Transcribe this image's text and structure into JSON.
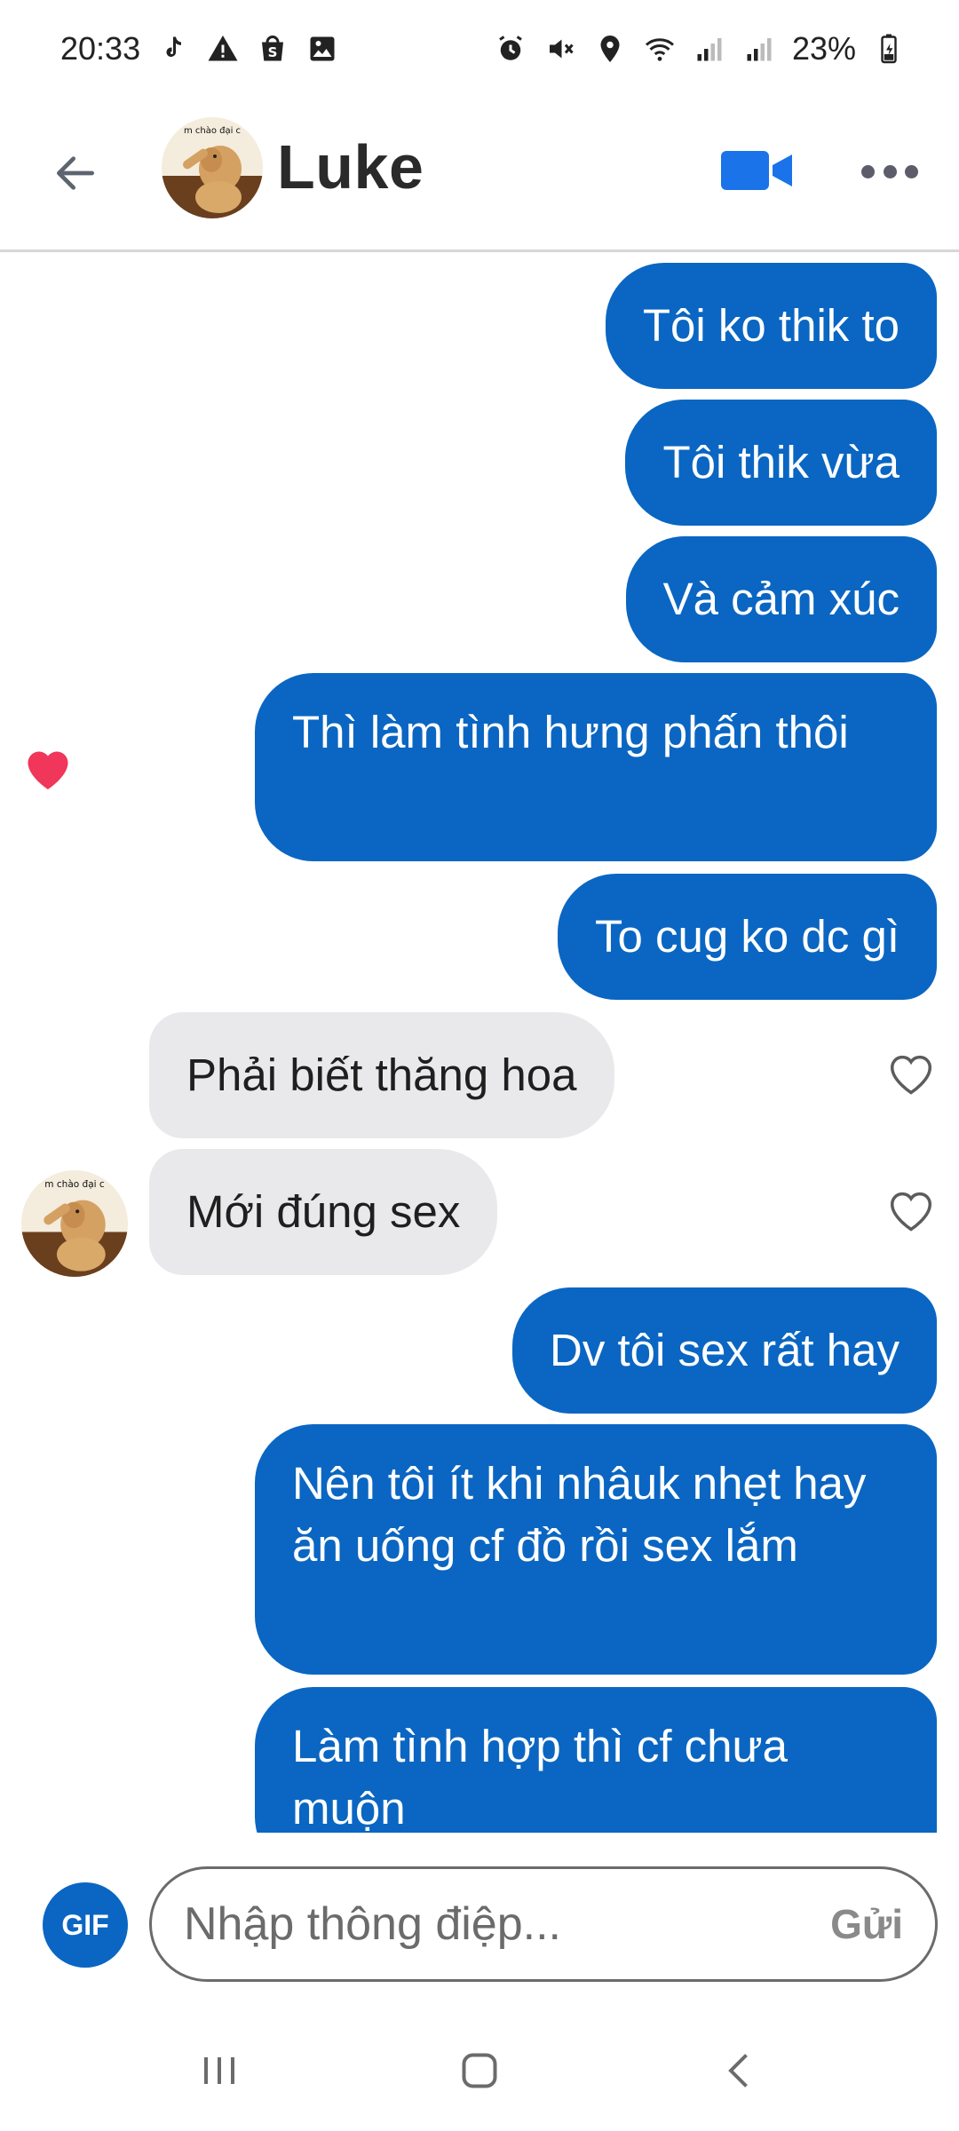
{
  "status_bar": {
    "time": "20:33",
    "battery": "23%",
    "left_icons": [
      "tiktok-icon",
      "warning-icon",
      "shopee-icon",
      "image-icon"
    ],
    "right_icons": [
      "alarm-icon",
      "mute-icon",
      "location-icon",
      "wifi-icon",
      "signal-icon",
      "signal-icon",
      "battery-icon"
    ]
  },
  "header": {
    "contact_name": "Luke",
    "avatar_caption": "m chào đại c",
    "actions": [
      "back-arrow-icon",
      "video-call-icon",
      "more-icon"
    ]
  },
  "messages": [
    {
      "direction": "out",
      "text": "Tôi ko thik to"
    },
    {
      "direction": "out",
      "text": "Tôi thik vừa"
    },
    {
      "direction": "out",
      "text": "Và cảm xúc"
    },
    {
      "direction": "out",
      "text": "Thì làm tình hưng phấn thôi",
      "reaction": "heart"
    },
    {
      "direction": "out",
      "text": "To cug ko dc gì"
    },
    {
      "direction": "in",
      "text": "Phải biết thăng hoa"
    },
    {
      "direction": "in",
      "text": "Mới đúng sex"
    },
    {
      "direction": "out",
      "text": "Dv tôi sex rất hay"
    },
    {
      "direction": "out",
      "text": "Nên tôi ít khi nhâuk nhẹt hay ăn uống cf đồ rồi sex lắm"
    },
    {
      "direction": "out",
      "text": "Làm tình hợp thì cf chưa muộn"
    }
  ],
  "composer": {
    "gif_label": "GIF",
    "placeholder": "Nhập thông điệp...",
    "send_label": "Gửi"
  },
  "colors": {
    "accent": "#0a66c2",
    "incoming_bubble": "#e9e9eb",
    "heart": "#f0365a"
  }
}
